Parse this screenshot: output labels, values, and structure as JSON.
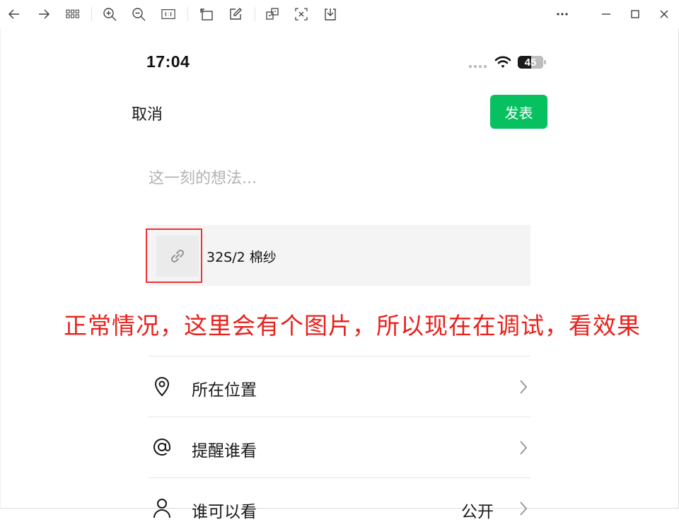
{
  "toolbar": {
    "icons": [
      "back-arrow-icon",
      "forward-arrow-icon",
      "grid-icon",
      "zoom-in-icon",
      "zoom-out-icon",
      "actual-size-icon",
      "rotate-icon",
      "edit-icon",
      "screenshot-icon",
      "translate-icon",
      "download-icon",
      "more-icon",
      "minimize-icon",
      "maximize-icon",
      "close-icon"
    ]
  },
  "status_bar": {
    "time": "17:04",
    "battery": "45"
  },
  "header": {
    "cancel_label": "取消",
    "publish_label": "发表",
    "publish_color": "#07c160"
  },
  "composer": {
    "placeholder": "这一刻的想法..."
  },
  "link_card": {
    "title": "32S/2 棉纱",
    "icon": "link-icon"
  },
  "annotation": {
    "text": "正常情况，这里会有个图片，所以现在在调试，看效果",
    "color": "#e8211c"
  },
  "options": [
    {
      "icon": "location-pin-icon",
      "label": "所在位置",
      "value": ""
    },
    {
      "icon": "at-sign-icon",
      "label": "提醒谁看",
      "value": ""
    },
    {
      "icon": "person-icon",
      "label": "谁可以看",
      "value": "公开"
    }
  ]
}
